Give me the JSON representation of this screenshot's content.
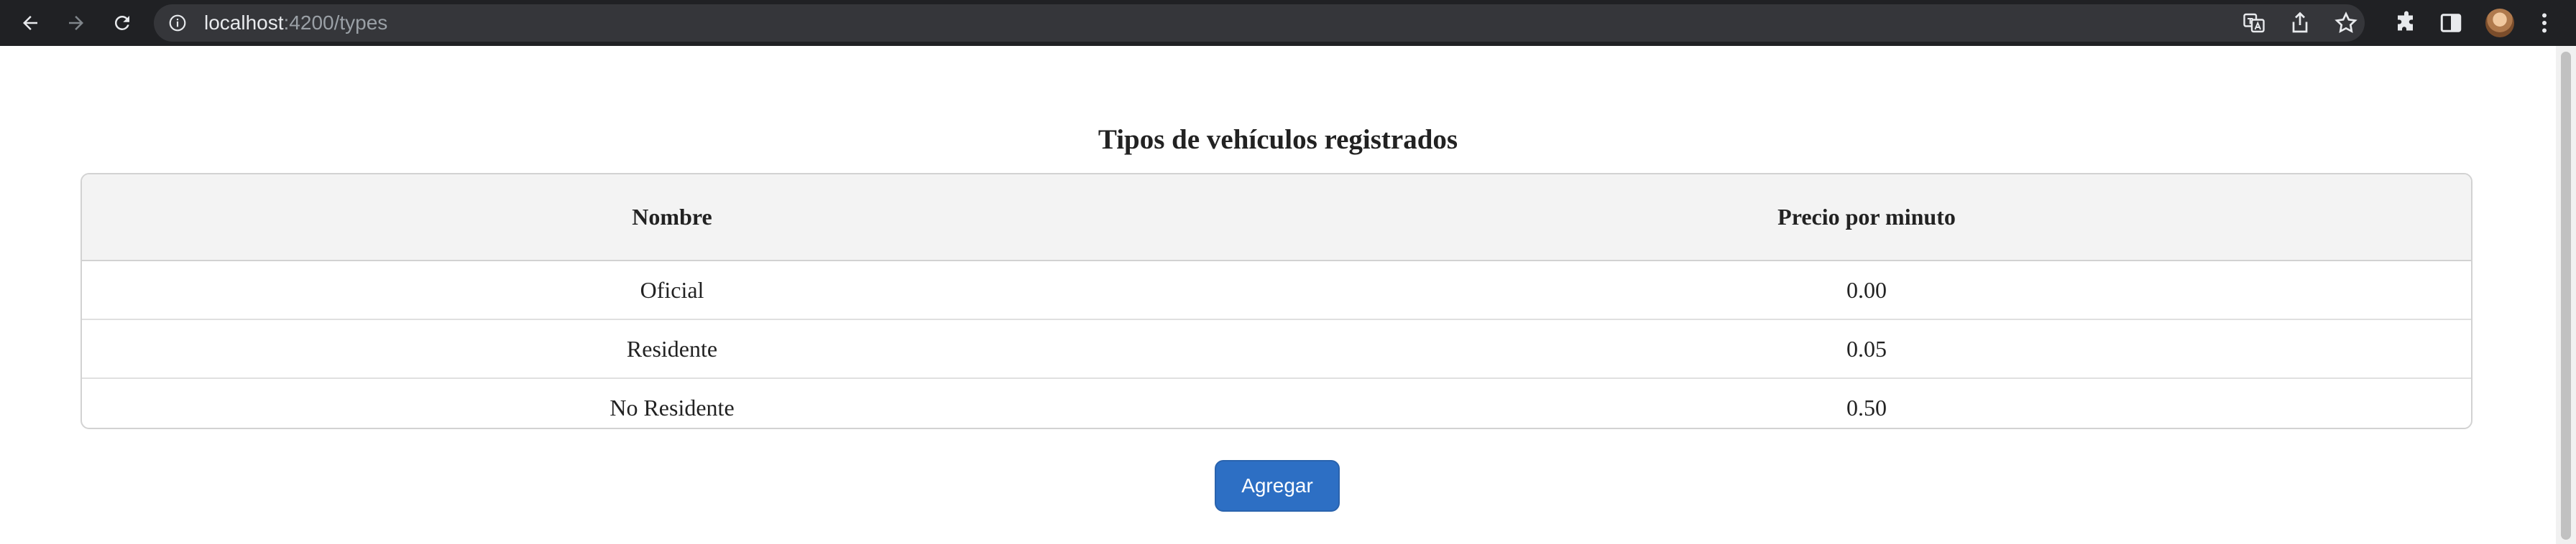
{
  "browser": {
    "url_host": "localhost",
    "url_path": ":4200/types"
  },
  "page": {
    "title": "Tipos de vehículos registrados",
    "table": {
      "headers": [
        "Nombre",
        "Precio por minuto"
      ],
      "rows": [
        [
          "Oficial",
          "0.00"
        ],
        [
          "Residente",
          "0.05"
        ],
        [
          "No Residente",
          "0.50"
        ]
      ]
    },
    "add_button": "Agregar"
  },
  "colors": {
    "chrome_bg": "#202124",
    "button_bg": "#2d6fc4"
  }
}
